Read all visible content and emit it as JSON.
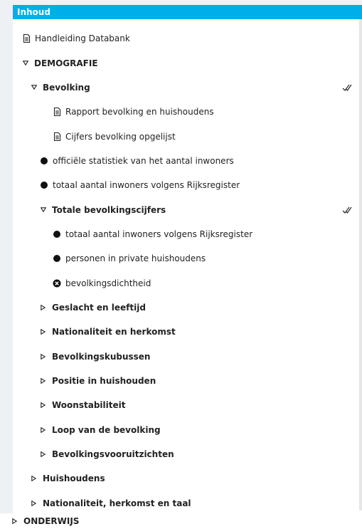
{
  "header": {
    "title": "Inhoud"
  },
  "tree": {
    "handleiding": "Handleiding Databank",
    "demografie": "DEMOGRAFIE",
    "bevolking": "Bevolking",
    "rapport": "Rapport bevolking en huishoudens",
    "cijfers": "Cijfers bevolking opgelijst",
    "officiele": "officiële statistiek van het aantal inwoners",
    "totaal_rr": "totaal aantal inwoners volgens Rijksregister",
    "totale_cijfers": "Totale bevolkingscijfers",
    "totaal_rr_sub": "totaal aantal inwoners volgens Rijksregister",
    "private": "personen in private huishoudens",
    "dichtheid": "bevolkingsdichtheid",
    "geslacht": "Geslacht en leeftijd",
    "nationaliteit": "Nationaliteit en herkomst",
    "kubussen": "Bevolkingskubussen",
    "positie": "Positie in huishouden",
    "woonstabiliteit": "Woonstabiliteit",
    "loop": "Loop van de bevolking",
    "vooruitzichten": "Bevolkingsvooruitzichten",
    "huishoudens": "Huishoudens",
    "nat_taal": "Nationaliteit, herkomst en taal",
    "onderwijs": "ONDERWIJS"
  },
  "colors": {
    "accent": "#00aee8"
  }
}
